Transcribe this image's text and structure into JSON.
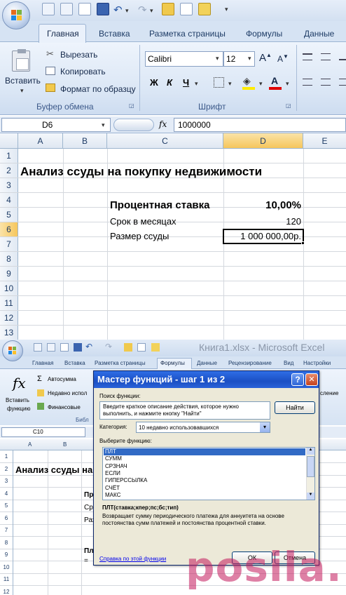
{
  "top": {
    "tabs": [
      "Главная",
      "Вставка",
      "Разметка страницы",
      "Формулы",
      "Данные"
    ],
    "clipboard": {
      "paste": "Вставить",
      "cut": "Вырезать",
      "copy": "Копировать",
      "format_painter": "Формат по образцу",
      "group": "Буфер обмена"
    },
    "font": {
      "name": "Calibri",
      "size": "12",
      "group": "Шрифт",
      "bold": "Ж",
      "italic": "К",
      "underline": "Ч"
    },
    "namebox": "D6",
    "fx": "fx",
    "formula": "1000000",
    "columns": [
      "A",
      "B",
      "C",
      "D",
      "E"
    ],
    "rows": [
      "1",
      "2",
      "3",
      "4",
      "5",
      "6",
      "7",
      "8",
      "9",
      "10",
      "11",
      "12",
      "13"
    ],
    "cells": {
      "title": "Анализ ссуды на покупку недвижимости",
      "rate_label": "Процентная ставка",
      "rate_value": "10,00%",
      "term_label": "Срок в месяцах",
      "term_value": "120",
      "amount_label": "Размер ссуды",
      "amount_value": "1 000 000,00р."
    }
  },
  "bottom": {
    "title": "Книга1.xlsx - Microsoft Excel",
    "tabs": [
      "Главная",
      "Вставка",
      "Разметка страницы",
      "Формулы",
      "Данные",
      "Рецензирование",
      "Вид",
      "Настройки"
    ],
    "ribbon": {
      "insert_function_1": "Вставить",
      "insert_function_2": "функцию",
      "autosum": "Автосумма",
      "recent": "Недавно испол",
      "financial": "Финансовые",
      "library": "Библ",
      "right_partial": "сление"
    },
    "namebox": "C10",
    "columns": [
      "A",
      "B"
    ],
    "rows": [
      "1",
      "2",
      "3",
      "4",
      "5",
      "6",
      "7",
      "8",
      "9",
      "10",
      "11",
      "12"
    ],
    "cells": {
      "title": "Анализ ссуды на",
      "r4": "Пр",
      "r5": "Сро",
      "r6": "Раз",
      "r9": "Пл",
      "r10": "="
    }
  },
  "dialog": {
    "title": "Мастер функций - шаг 1 из 2",
    "help": "?",
    "close": "✕",
    "search_label": "Поиск функции:",
    "search_text": "Введите краткое описание действия, которое нужно выполнить, и нажмите кнопку \"Найти\"",
    "find_button": "Найти",
    "category_label": "Категория:",
    "category_value": "10 недавно использовавшихся",
    "choose_label": "Выберите функцию:",
    "functions": [
      "ПЛТ",
      "СУММ",
      "СРЗНАЧ",
      "ЕСЛИ",
      "ГИПЕРССЫЛКА",
      "СЧЁТ",
      "МАКС"
    ],
    "signature": "ПЛТ(ставка;кпер;пс;бс;тип)",
    "description": "Возвращает сумму периодического платежа для аннуитета на основе постоянства сумм платежей и постоянства процентной ставки.",
    "help_link": "Справка по этой функции",
    "ok": "ОК",
    "cancel": "Отмена"
  },
  "watermark": "posila.ru",
  "colors": {
    "ribbon_bg": "#dbe7f5",
    "ribbon_border": "#9bb3d3",
    "accent": "#1e3c66",
    "dialog_title": "#2758c8",
    "selected": "#316ac5",
    "watermark": "#c2185b"
  }
}
